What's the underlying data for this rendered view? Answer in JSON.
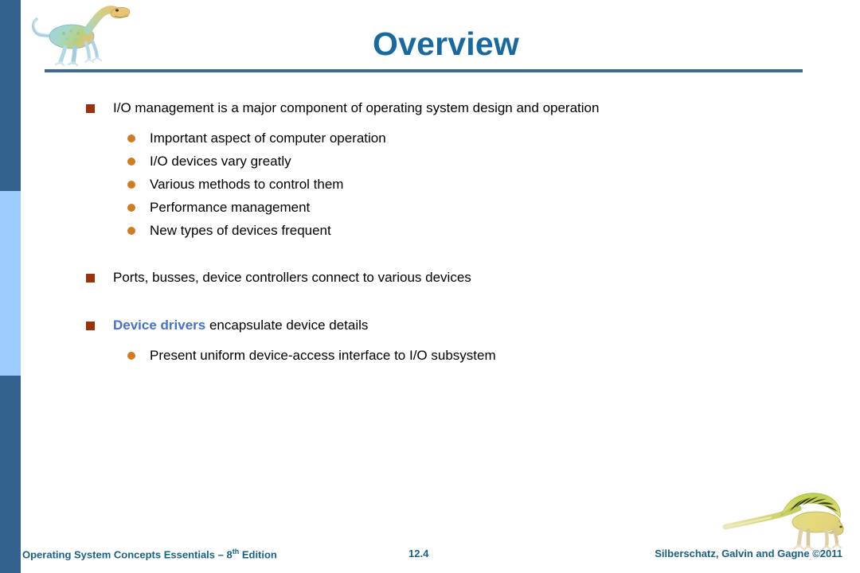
{
  "slide": {
    "title": "Overview",
    "page_number": "12.4"
  },
  "theme": {
    "title_color": "#19699e",
    "rule_color": "#3d6895",
    "sidebar_dark": "#33628f",
    "sidebar_light": "#9bcbff",
    "bullet_square_color": "#99330a",
    "bullet_circle_color": "#cf7c22",
    "emphasis_color": "#4472c8",
    "footer_color": "#1a5f86"
  },
  "content": {
    "blocks": [
      {
        "level": 1,
        "marker": "square-bullet-icon",
        "text": "I/O management is a major component of operating system design and operation"
      },
      {
        "level": 2,
        "marker": "round-bullet-icon",
        "text": "Important aspect of computer operation"
      },
      {
        "level": 2,
        "marker": "round-bullet-icon",
        "text": "I/O devices vary greatly"
      },
      {
        "level": 2,
        "marker": "round-bullet-icon",
        "text": "Various methods to control them"
      },
      {
        "level": 2,
        "marker": "round-bullet-icon",
        "text": "Performance management"
      },
      {
        "level": 2,
        "marker": "round-bullet-icon",
        "text": "New types of devices frequent"
      },
      {
        "level": 1,
        "marker": "square-bullet-icon",
        "text": "Ports, busses, device controllers connect to various devices"
      },
      {
        "level": 1,
        "marker": "square-bullet-icon",
        "emphasis": "Device drivers",
        "text": " encapsulate device details"
      },
      {
        "level": 2,
        "marker": "round-bullet-icon",
        "text": "Present uniform device-access interface to I/O subsystem"
      }
    ]
  },
  "footer": {
    "book_title_main": "Operating System Concepts Essentials – 8",
    "book_title_sup": "th",
    "book_title_tail": " Edition",
    "page_number": "12.4",
    "credit": "Silberschatz, Galvin and Gagne ©2011"
  },
  "decorations": {
    "top_left_image": "dinosaur-illustration",
    "bottom_right_image": "sailback-dinosaur-illustration"
  }
}
